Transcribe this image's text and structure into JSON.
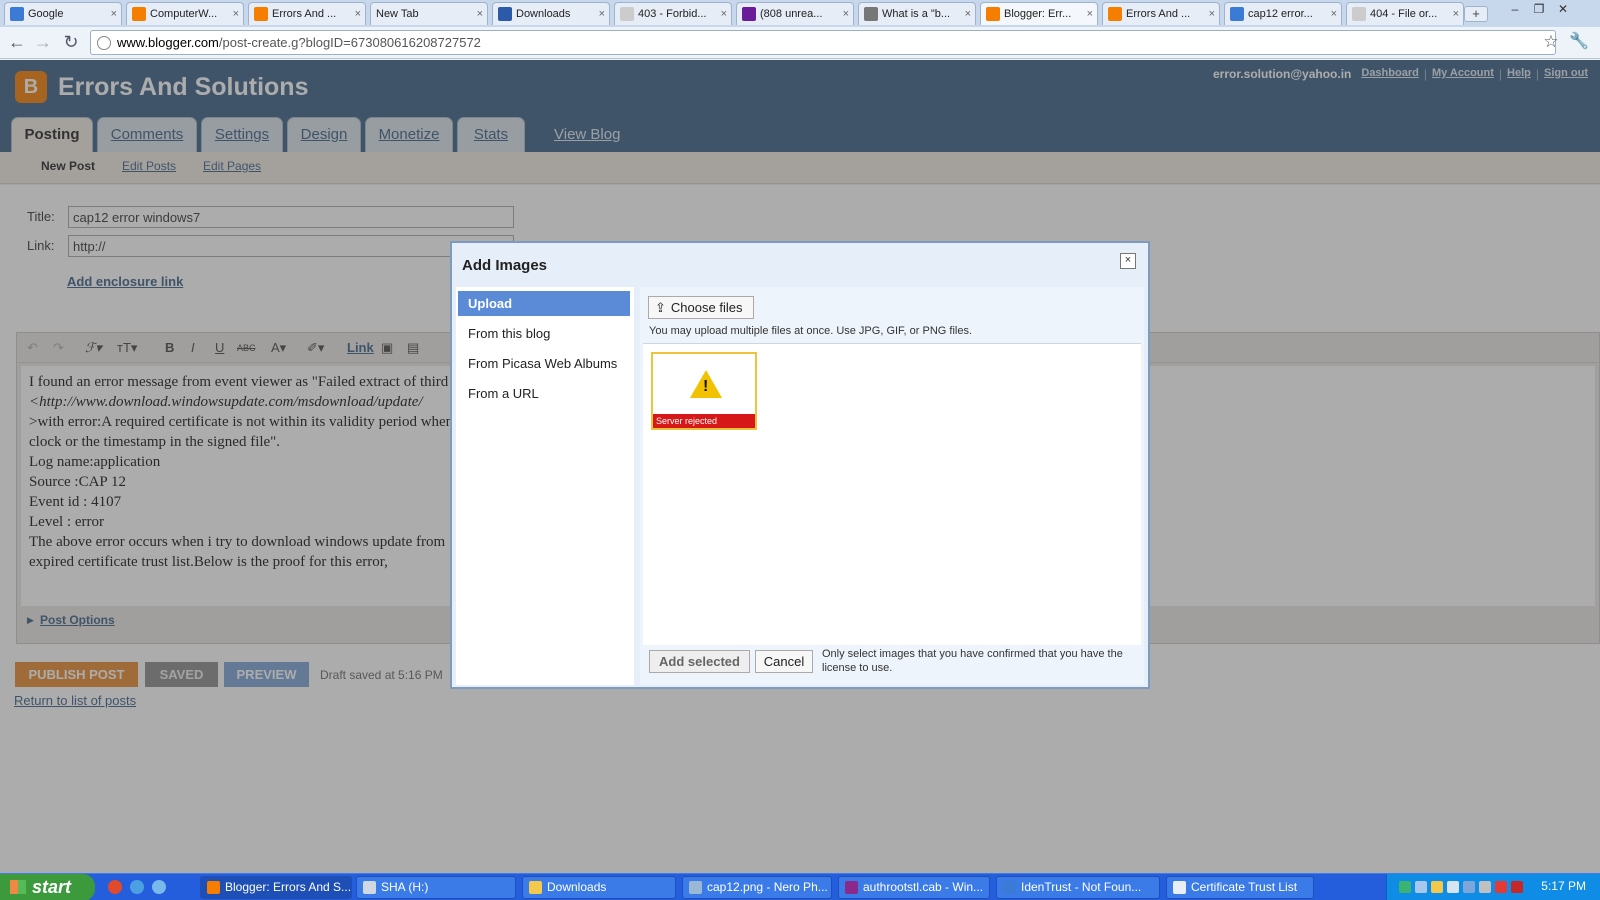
{
  "browser": {
    "tabs": [
      {
        "title": "Google",
        "icon": "google-icon",
        "color": "#3b7bd6"
      },
      {
        "title": "ComputerW...",
        "icon": "blogger-icon",
        "color": "#f57d00"
      },
      {
        "title": "Errors And ...",
        "icon": "blogger-icon",
        "color": "#f57d00"
      },
      {
        "title": "New Tab",
        "icon": "",
        "color": ""
      },
      {
        "title": "Downloads",
        "icon": "download-icon",
        "color": "#2b5aa8"
      },
      {
        "title": "403 - Forbid...",
        "icon": "page-icon",
        "color": "#cccccc"
      },
      {
        "title": "(808 unrea...",
        "icon": "yahoo-icon",
        "color": "#6a1b9a"
      },
      {
        "title": "What is a \"b...",
        "icon": "person-icon",
        "color": "#777777"
      },
      {
        "title": "Blogger: Err...",
        "icon": "blogger-icon",
        "color": "#f57d00",
        "active": true
      },
      {
        "title": "Errors And ...",
        "icon": "blogger-icon",
        "color": "#f57d00"
      },
      {
        "title": "cap12 error...",
        "icon": "google-icon",
        "color": "#3b7bd6"
      },
      {
        "title": "404 - File or...",
        "icon": "page-icon",
        "color": "#cccccc"
      }
    ],
    "url_domain": "www.blogger.com",
    "url_path": "/post-create.g?blogID=673080616208727572"
  },
  "blogger": {
    "logo": "B",
    "title": "Errors And Solutions",
    "email": "error.solution@yahoo.in",
    "links": [
      "Dashboard",
      "My Account",
      "Help",
      "Sign out"
    ],
    "tabs": [
      "Posting",
      "Comments",
      "Settings",
      "Design",
      "Monetize",
      "Stats"
    ],
    "view_blog": "View Blog",
    "subnav": [
      "New Post",
      "Edit Posts",
      "Edit Pages"
    ]
  },
  "post": {
    "title_label": "Title:",
    "title_value": "cap12 error windows7",
    "link_label": "Link:",
    "link_value": "http://",
    "enclosure": "Add enclosure link",
    "toolbar_link": "Link",
    "body_lines": [
      "I found an error message from event viewer as \"Failed extract of third p",
      "<http://www.download.windowsupdate.com/msdownload/update/",
      ">with error:A required certificate is not within its validity period when v",
      "clock or the timestamp in the signed file\".",
      "Log name:application",
      "Source :CAP 12",
      "Event id : 4107",
      "Level : error",
      "The above error occurs when i try to download windows update from",
      "expired certificate trust list.Below is the proof for this error,"
    ],
    "post_options": "Post Options",
    "publish": "PUBLISH POST",
    "saved": "SAVED",
    "preview": "PREVIEW",
    "draft": "Draft saved at 5:16 PM",
    "return": "Return to list of posts"
  },
  "dialog": {
    "title": "Add Images",
    "close": "×",
    "sources": [
      "Upload",
      "From this blog",
      "From Picasa Web Albums",
      "From a URL"
    ],
    "choose_files": "Choose files",
    "upload_hint": "You may upload multiple files at once. Use JPG, GIF, or PNG files.",
    "thumb_status": "Server rejected",
    "add_selected": "Add selected",
    "cancel": "Cancel",
    "license": "Only select images that you have confirmed that you have the license to use."
  },
  "taskbar": {
    "start": "start",
    "items": [
      {
        "label": "Blogger: Errors And S...",
        "active": true,
        "color": "#f57d00"
      },
      {
        "label": "SHA (H:)",
        "color": "#cfd8e3"
      },
      {
        "label": "Downloads",
        "color": "#f2c94c"
      },
      {
        "label": "cap12.png - Nero Ph...",
        "color": "#9ab8d6"
      },
      {
        "label": "authrootstl.cab - Win...",
        "color": "#8b2a8b"
      },
      {
        "label": "IdenTrust - Not Foun...",
        "color": "#3b7bd6"
      },
      {
        "label": "Certificate Trust List",
        "color": "#e8eef6"
      }
    ],
    "clock": "5:17 PM"
  }
}
